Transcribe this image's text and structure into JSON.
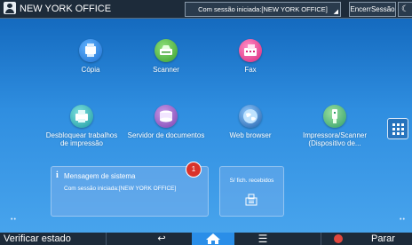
{
  "header": {
    "office_name": "NEW YORK OFFICE",
    "session_status": "Com sessão iniciada:[NEW YORK OFFICE]",
    "logout_label": "EncerrSessão",
    "energy_icon": "moon-icon"
  },
  "apps": {
    "copy": {
      "label": "Cópia",
      "icon": "copy-icon"
    },
    "scanner": {
      "label": "Scanner",
      "icon": "scanner-icon"
    },
    "fax": {
      "label": "Fax",
      "icon": "fax-icon"
    },
    "unlock_jobs": {
      "label_line1": "Desbloquear trabalhos",
      "label_line2": "de impressão",
      "icon": "unlock-print-icon"
    },
    "document_server": {
      "label": "Servidor de documentos",
      "icon": "document-server-icon"
    },
    "web_browser": {
      "label": "Web browser",
      "icon": "globe-icon"
    },
    "printer_scanner": {
      "label_line1": "Impressora/Scanner",
      "label_line2": "(Dispositivo de...",
      "icon": "usb-device-icon"
    }
  },
  "widgets": {
    "system_message": {
      "title": "Mensagem de sistema",
      "body": "Com sessão iniciada:[NEW YORK OFFICE]",
      "badge_count": "1"
    },
    "fax_received": {
      "label": "S/ fich. recebidos"
    }
  },
  "footer": {
    "check_status_label": "Verificar estado",
    "back_icon": "back-arrow-icon",
    "home_icon": "home-icon",
    "menu_icon": "menu-icon",
    "stop_label": "Parar"
  },
  "colors": {
    "top_bar": "#1d2b3a",
    "background_top": "#0f63b8",
    "home_active": "#2a8ee8",
    "badge": "#d9332b",
    "stop": "#e0473e"
  }
}
